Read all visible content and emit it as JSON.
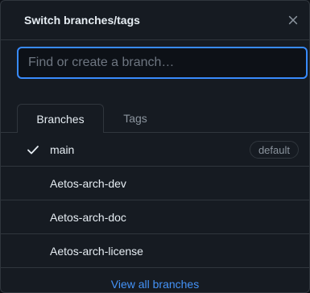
{
  "header": {
    "title": "Switch branches/tags",
    "close_icon": "close-icon"
  },
  "search": {
    "value": "",
    "placeholder": "Find or create a branch…"
  },
  "tabs": [
    {
      "label": "Branches",
      "active": true
    },
    {
      "label": "Tags",
      "active": false
    }
  ],
  "branches": [
    {
      "label": "main",
      "selected": true,
      "badge": "default"
    },
    {
      "label": "Aetos-arch-dev",
      "selected": false
    },
    {
      "label": "Aetos-arch-doc",
      "selected": false
    },
    {
      "label": "Aetos-arch-license",
      "selected": false
    }
  ],
  "footer": {
    "link_label": "View all branches"
  },
  "colors": {
    "accent": "#388bfd",
    "link": "#4493f8",
    "background": "#161b22",
    "border": "#30363d"
  }
}
